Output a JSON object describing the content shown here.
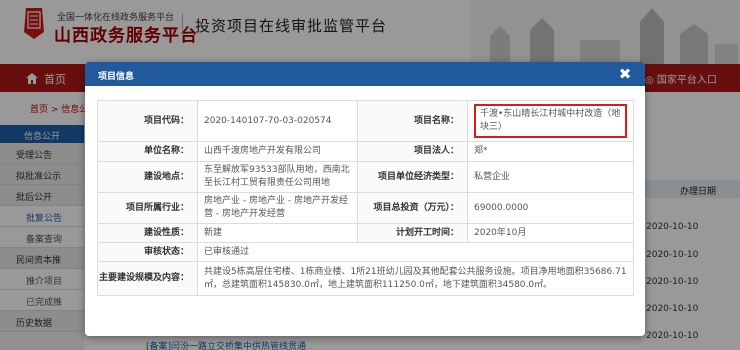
{
  "header": {
    "site_top": "全国一体化在线政务服务平台",
    "site_main": "山西政务服务平台",
    "platform_title": "投资项目在线审批监管平台"
  },
  "nav": {
    "home": "首页",
    "national": "国家平台入口"
  },
  "breadcrumb": "首页 > 信息公",
  "left_nav": {
    "head": "信息公开",
    "items": [
      {
        "label": "受理公告",
        "sub": false
      },
      {
        "label": "拟批准公示",
        "sub": false
      },
      {
        "label": "批后公开",
        "sub": false
      },
      {
        "label": "批复公告",
        "sub": true,
        "active": true
      },
      {
        "label": "备案查询",
        "sub": true
      },
      {
        "label": "民间资本推",
        "sub": false
      },
      {
        "label": "推介项目",
        "sub": true
      },
      {
        "label": "已完成推",
        "sub": true
      },
      {
        "label": "历史数据",
        "sub": false
      }
    ]
  },
  "background_table": {
    "col_head": "办理日期",
    "dates": [
      "2020-10-10",
      "2020-10-10",
      "2020-10-10",
      "2020-10-10",
      "2020-10-10"
    ]
  },
  "bottom_link": "[备案]闫汾一路立交桥集中供热管线贯通",
  "dialog": {
    "title": "项目信息",
    "close": "✖",
    "rows": [
      {
        "l1": "项目代码：",
        "v1": "2020-140107-70-03-020574",
        "l2": "项目名称：",
        "v2": "千渡•东山晴长江村城中村改造（地块三）",
        "highlight": true
      },
      {
        "l1": "单位名称：",
        "v1": "山西千渡房地产开发有限公司",
        "l2": "项目法人：",
        "v2": "郑*"
      },
      {
        "l1": "建设地点：",
        "v1": "东至解放军93533部队用地，西南北至长江村工贸有限责任公司用地",
        "l2": "项目单位经济类型：",
        "v2": "私营企业"
      },
      {
        "l1": "项目所属行业：",
        "v1": "房地产业 - 房地产业 - 房地产开发经营 - 房地产开发经营",
        "l2": "项目总投资（万元）：",
        "v2": "69000.0000"
      },
      {
        "l1": "建设性质：",
        "v1": "新建",
        "l2": "计划开工时间：",
        "v2": "2020年10月"
      },
      {
        "l1": "审核状态：",
        "v1": "已审核通过"
      },
      {
        "l1": "主要建设规模及内容：",
        "v1": "共建设5栋高层住宅楼、1栋商业楼、1所21班幼儿园及其他配套公共服务设施。项目净用地面积35686.71㎡，总建筑面积145830.0㎡，地上建筑面积111250.0㎡，地下建筑面积34580.0㎡。"
      }
    ]
  },
  "colors": {
    "nav_red": "#b01818",
    "dialog_blue": "#215a9c",
    "highlight_red": "#e01818"
  }
}
